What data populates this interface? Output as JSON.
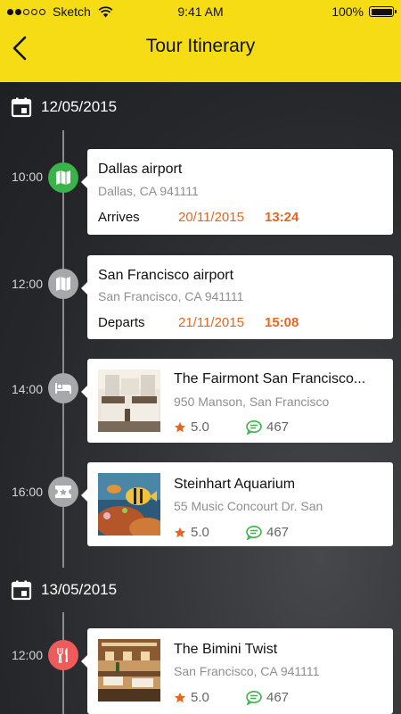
{
  "status_bar": {
    "carrier": "Sketch",
    "time": "9:41 AM",
    "battery": "100%"
  },
  "header": {
    "title": "Tour Itinerary"
  },
  "colors": {
    "header_bg": "#f6dc15",
    "accent_orange": "#e8651d",
    "green": "#39b34a",
    "node_gray": "#a7a8aa",
    "red": "#ef5b5b",
    "review_green": "#39b34a"
  },
  "days": [
    {
      "date": "12/05/2015",
      "items": [
        {
          "time": "10:00",
          "icon": "map-icon",
          "title": "Dallas airport",
          "address": "Dallas, CA 941111",
          "status": "Arrives",
          "status_date": "20/11/2015",
          "status_time": "13:24"
        },
        {
          "time": "12:00",
          "icon": "map-icon",
          "title": "San Francisco airport",
          "address": "San Francisco, CA 941111",
          "status": "Departs",
          "status_date": "21/11/2015",
          "status_time": "15:08"
        },
        {
          "time": "14:00",
          "icon": "bed-icon",
          "title": "The Fairmont San Francisco...",
          "address": "950 Manson, San Francisco",
          "rating": "5.0",
          "reviews": "467"
        },
        {
          "time": "16:00",
          "icon": "ticket-icon",
          "title": "Steinhart Aquarium",
          "address": "55 Music Concourt Dr. San",
          "rating": "5.0",
          "reviews": "467"
        }
      ]
    },
    {
      "date": "13/05/2015",
      "items": [
        {
          "time": "12:00",
          "icon": "utensils-icon",
          "title": "The Bimini Twist",
          "address": "San Francisco, CA 941111",
          "rating": "5.0",
          "reviews": "467"
        }
      ]
    }
  ]
}
